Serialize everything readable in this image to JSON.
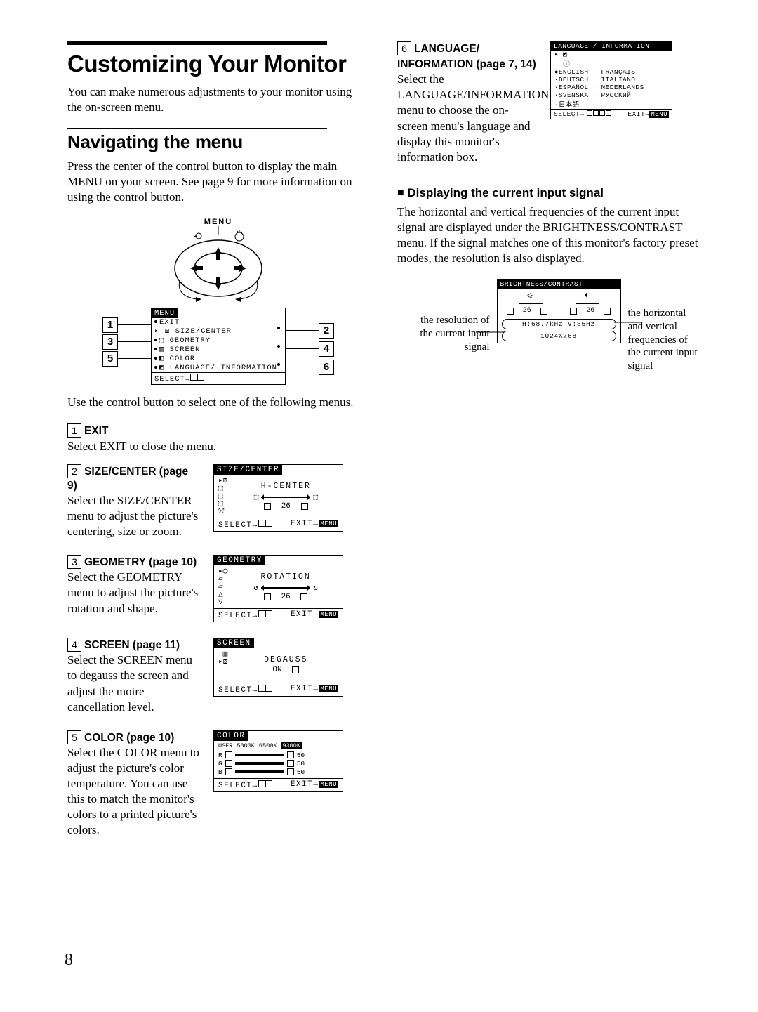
{
  "page_number": "8",
  "h1": "Customizing Your Monitor",
  "intro": "You can make numerous adjustments to your monitor using the on-screen menu.",
  "h2": "Navigating the menu",
  "nav_intro": "Press the center of the control button to display the main MENU on your screen. See page 9 for more information on using the control button.",
  "menu_label": "MENU",
  "main_menu": {
    "title": "MENU",
    "items": [
      "EXIT",
      "SIZE/CENTER",
      "GEOMETRY",
      "SCREEN",
      "COLOR",
      "LANGUAGE/ INFORMATION"
    ],
    "select": "SELECT→"
  },
  "use_control": "Use the control button to select one of the following menus.",
  "items": [
    {
      "num": "1",
      "title": "EXIT",
      "desc": "Select EXIT to close the menu."
    },
    {
      "num": "2",
      "title": "SIZE/CENTER (page 9)",
      "desc": "Select the SIZE/CENTER menu to adjust the picture's centering, size or zoom."
    },
    {
      "num": "3",
      "title": "GEOMETRY (page 10)",
      "desc": "Select the GEOMETRY menu to adjust the picture's rotation and shape."
    },
    {
      "num": "4",
      "title": "SCREEN (page 11)",
      "desc": "Select the SCREEN menu to degauss the screen and adjust the moire cancellation level."
    },
    {
      "num": "5",
      "title": "COLOR (page 10)",
      "desc": "Select the COLOR menu to adjust the picture's color temperature. You can use this to match the monitor's colors to a printed picture's colors."
    }
  ],
  "osd_size": {
    "title": "SIZE/CENTER",
    "label": "H-CENTER",
    "value": "26",
    "select": "SELECT→",
    "exit": "EXIT→",
    "exit_badge": "MENU"
  },
  "osd_geom": {
    "title": "GEOMETRY",
    "label": "ROTATION",
    "value": "26",
    "select": "SELECT→",
    "exit": "EXIT→",
    "exit_badge": "MENU"
  },
  "osd_screen": {
    "title": "SCREEN",
    "label": "DEGAUSS",
    "value": "ON",
    "select": "SELECT→",
    "exit": "EXIT→",
    "exit_badge": "MENU"
  },
  "osd_color": {
    "title": "COLOR",
    "presets": [
      "USER",
      "5000K",
      "6500K",
      "9300K"
    ],
    "rows": [
      {
        "c": "R",
        "v": "50"
      },
      {
        "c": "G",
        "v": "50"
      },
      {
        "c": "B",
        "v": "50"
      }
    ],
    "select": "SELECT→",
    "exit": "EXIT→",
    "exit_badge": "MENU"
  },
  "lang": {
    "num": "6",
    "title": "LANGUAGE/ INFORMATION (page 7, 14)",
    "desc": "Select the LANGUAGE/INFORMATION menu to choose the on-screen menu's language and display this monitor's information box."
  },
  "osd_lang": {
    "title": "LANGUAGE / INFORMATION",
    "languages": [
      [
        "ENGLISH",
        "FRANÇAIS"
      ],
      [
        "DEUTSCH",
        "ITALIANO"
      ],
      [
        "ESPAÑOL",
        "NEDERLANDS"
      ],
      [
        "SVENSKA",
        "РУССКИЙ"
      ],
      [
        "日本語",
        ""
      ]
    ],
    "select": "SELECT→",
    "exit": "EXIT→",
    "exit_badge": "MENU"
  },
  "signal_h3": "Displaying the current input signal",
  "signal_p": "The horizontal and vertical frequencies of the current input signal are displayed under the BRIGHTNESS/CONTRAST menu. If the signal matches one of this monitor's factory preset modes, the resolution is also displayed.",
  "osd_bc": {
    "title": "BRIGHTNESS/CONTRAST",
    "v1": "26",
    "v2": "26",
    "hv": "H:68.7kHz V:85Hz",
    "res": "1024X768"
  },
  "cap_left": "the resolution of the current input signal",
  "cap_right": "the horizontal and vertical frequencies of the current input signal"
}
